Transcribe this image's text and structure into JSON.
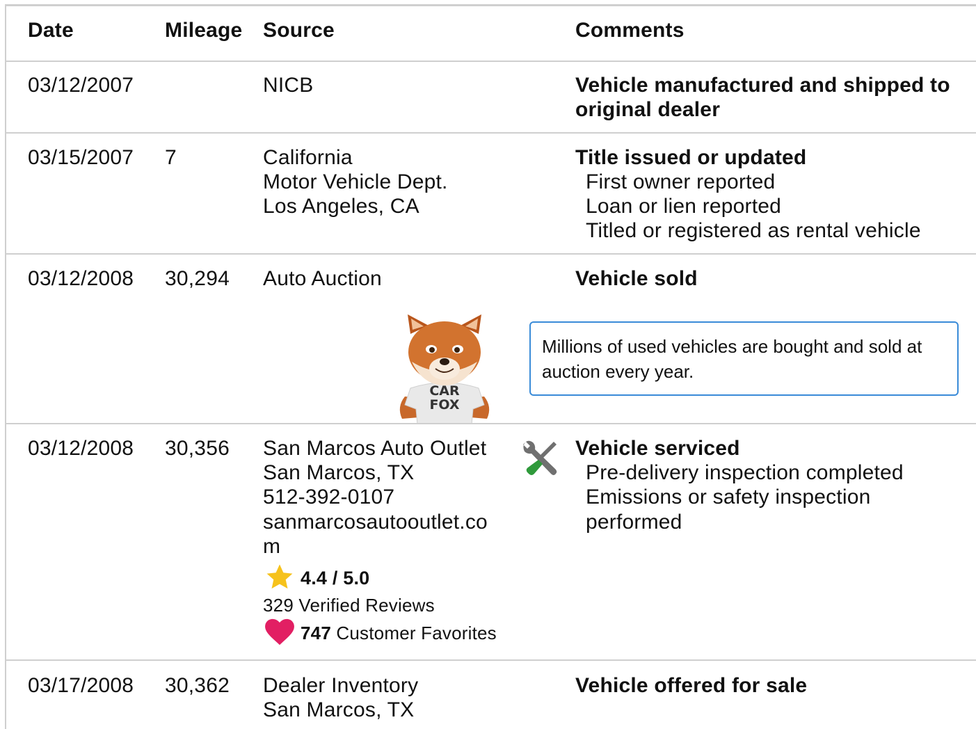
{
  "headers": {
    "date": "Date",
    "mileage": "Mileage",
    "source": "Source",
    "comments": "Comments"
  },
  "rows": [
    {
      "date": "03/12/2007",
      "mileage": "",
      "source": [
        "NICB"
      ],
      "comment_title": "Vehicle manufactured and shipped to",
      "comment_title_2": "original dealer",
      "comment_items": []
    },
    {
      "date": "03/15/2007",
      "mileage": "7",
      "source": [
        "California",
        "Motor Vehicle Dept.",
        "Los Angeles, CA"
      ],
      "comment_title": "Title issued or updated",
      "comment_items": [
        "First owner reported",
        "Loan or lien reported",
        "Titled or registered as rental vehicle"
      ]
    },
    {
      "date": "03/12/2008",
      "mileage": "30,294",
      "source": [
        "Auto Auction"
      ],
      "comment_title": "Vehicle sold",
      "comment_items": [],
      "callout": "Millions of used vehicles are bought and sold at auction every year.",
      "mascot_shirt": [
        "CAR",
        "FOX"
      ]
    },
    {
      "date": "03/12/2008",
      "mileage": "30,356",
      "source": [
        "San Marcos Auto Outlet",
        "San Marcos, TX",
        "512-392-0107",
        "sanmarcosautooutlet.co",
        "m"
      ],
      "rating": "4.4 / 5.0",
      "reviews": "329 Verified Reviews",
      "favorites_count": "747",
      "favorites_label": "Customer Favorites",
      "comment_title": "Vehicle serviced",
      "comment_items": [
        "Pre-delivery inspection completed",
        "Emissions or safety inspection",
        "performed"
      ],
      "service_icon": "wrench-screwdriver-icon"
    },
    {
      "date": "03/17/2008",
      "mileage": "30,362",
      "source": [
        "Dealer Inventory",
        "San Marcos, TX"
      ],
      "comment_title": "Vehicle offered for sale",
      "comment_items": []
    }
  ],
  "colors": {
    "star": "#f6c21c",
    "heart": "#e21f63",
    "callout_border": "#3a8bd8",
    "rule": "#cfcfcf"
  }
}
